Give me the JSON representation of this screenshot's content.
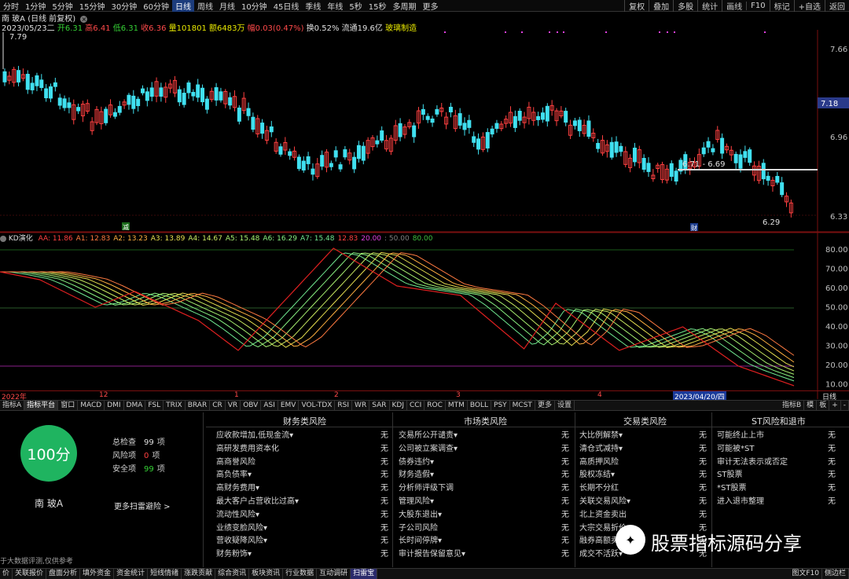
{
  "periods": [
    "分时",
    "1分钟",
    "5分钟",
    "15分钟",
    "30分钟",
    "60分钟",
    "日线",
    "周线",
    "月线",
    "10分钟",
    "45日线",
    "季线",
    "年线",
    "5秒",
    "15秒",
    "多周期",
    "更多"
  ],
  "active_period": "日线",
  "top_right": [
    "复权",
    "叠加",
    "多股",
    "统计",
    "画线",
    "F10",
    "标记",
    "+自选",
    "返回"
  ],
  "stock": {
    "title": "南 玻A (日线 前复权)",
    "date": "2023/05/23二",
    "open": "开6.31",
    "high": "高6.41",
    "low": "低6.31",
    "close": "收6.36",
    "vol": "量101801",
    "amount": "额6483万",
    "change": "幅0.03(0.47%)",
    "turnover": "换0.52%",
    "float": "流通19.6亿",
    "tag": "玻璃制造"
  },
  "price_labels": {
    "max": "7.79",
    "level_line": "6.71 - 6.69",
    "min": "6.29",
    "current": "7.18",
    "axis": [
      "7.66",
      "6.96",
      "6.33"
    ]
  },
  "markers": {
    "a": "减",
    "b": "财"
  },
  "kd": {
    "name": "KD演化",
    "values": [
      {
        "t": "AA: 11.86",
        "c": "#ff4040"
      },
      {
        "t": "A1: 12.83",
        "c": "#ff7a40"
      },
      {
        "t": "A2: 13.23",
        "c": "#ffb040"
      },
      {
        "t": "A3: 13.89",
        "c": "#e8e050"
      },
      {
        "t": "A4: 14.67",
        "c": "#c8e860"
      },
      {
        "t": "A5: 15.48",
        "c": "#a8f070"
      },
      {
        "t": "A6: 16.29",
        "c": "#88f080"
      },
      {
        "t": "A7: 15.48",
        "c": "#70e890"
      },
      {
        "t": "12.83",
        "c": "#ff4040"
      },
      {
        "t": "20.00",
        "c": "#e040e0"
      },
      {
        "t": ": 50.00",
        "c": "#808080"
      },
      {
        "t": "80.00",
        "c": "#40c040"
      }
    ],
    "axis": [
      "80.00",
      "70.00",
      "60.00",
      "50.00",
      "40.00",
      "30.00",
      "20.00",
      "10.00"
    ]
  },
  "time_axis": {
    "items": [
      "2022年",
      "12",
      "1",
      "2",
      "3",
      "4"
    ],
    "highlight": "2023/04/20/四",
    "period": "日线"
  },
  "tabs": [
    "指标A",
    "指标平台",
    "窗口",
    "MACD",
    "DMI",
    "DMA",
    "FSL",
    "TRIX",
    "BRAR",
    "CR",
    "VR",
    "OBV",
    "ASI",
    "EMV",
    "VOL-TDX",
    "RSI",
    "WR",
    "SAR",
    "KDJ",
    "CCI",
    "ROC",
    "MTM",
    "BOLL",
    "PSY",
    "MCST",
    "更多",
    "设置"
  ],
  "tabs_right": [
    "指标B",
    "模",
    "板",
    "+",
    "-"
  ],
  "risk": {
    "score": "100分",
    "summary": [
      {
        "label": "总检查",
        "num": "99",
        "unit": "项",
        "c": "#e0e0e0"
      },
      {
        "label": "风险项",
        "num": "0",
        "unit": "项",
        "c": "#ff4040"
      },
      {
        "label": "安全项",
        "num": "99",
        "unit": "项",
        "c": "#35d135"
      }
    ],
    "name": "南 玻A",
    "more": "更多扫雷避险 >",
    "note": "于大数据评测,仅供参考",
    "columns": [
      {
        "title": "财务类风险",
        "items": [
          "应收款增加,低现金流▾",
          "高研发费用资本化",
          "高商誉风险",
          "高负债率▾",
          "高财务费用▾",
          "最大客户占营收比过高▾",
          "流动性风险▾",
          "业绩变脸风险▾",
          "营收疑降风险▾",
          "财务粉饰▾"
        ]
      },
      {
        "title": "市场类风险",
        "items": [
          "交易所公开谴责▾",
          "公司被立案调查▾",
          "债券违约▾",
          "财务造假▾",
          "分析师评级下调",
          "管理风险▾",
          "大股东退出▾",
          "子公司风险",
          "长时间停牌▾",
          "审计报告保留意见▾"
        ]
      },
      {
        "title": "交易类风险",
        "items": [
          "大比例解禁▾",
          "清仓式减持▾",
          "高质押风险",
          "股权冻结▾",
          "长期不分红",
          "关联交易风险▾",
          "北上资金卖出",
          "大宗交易折价",
          "融券高额卖出",
          "成交不活跃▾"
        ]
      },
      {
        "title": "ST风险和退市",
        "items": [
          "可能终止上市",
          "可能被*ST",
          "审计无法表示或否定",
          "ST股票",
          "*ST股票",
          "进入退市整理"
        ]
      }
    ],
    "value": "无"
  },
  "watermark": "股票指标源码分享",
  "bottom_tabs": [
    "价",
    "关联报价",
    "盘面分析",
    "填外资金",
    "资金统计",
    "短线情绪",
    "涨跌贡献",
    "综合资讯",
    "板块资讯",
    "行业数据",
    "互动调研",
    "扫雷宝"
  ],
  "bottom_right": [
    "图文F10",
    "侧边栏"
  ]
}
